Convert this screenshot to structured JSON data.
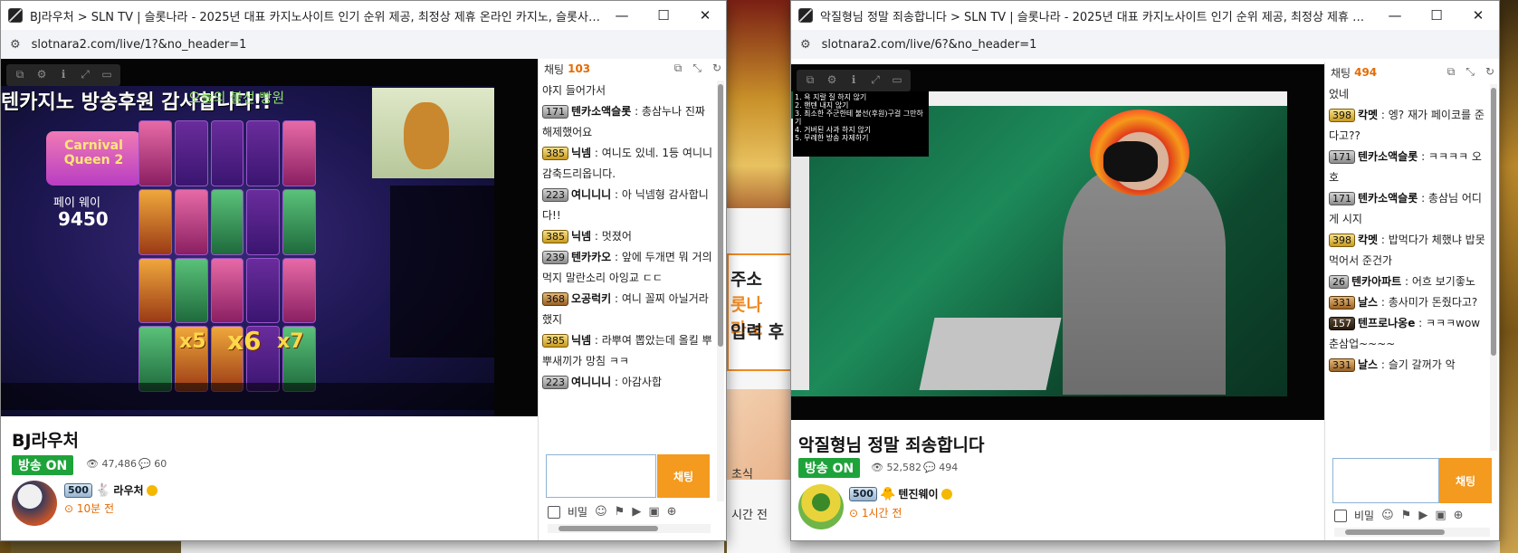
{
  "background": {
    "promo_line1": "주소",
    "promo_line2": "롯나라.c",
    "promo_line3": "입력 후",
    "side_text_1": "초식",
    "side_text_2": "시간 전"
  },
  "window1": {
    "title": "BJ라우처 > SLN TV | 슬롯나라 - 2025년 대표 카지노사이트 인기 순위 제공, 최정상 제휴 온라인 카지노, 슬롯사이트...",
    "url": "slotnara2.com/live/1?&no_header=1",
    "video": {
      "banner": "텐카지노 방송후원 감사합니다!!",
      "banner_sub": "오늘의 불선 빵원",
      "game_logo": "Carnival Queen 2",
      "payway_label": "페이 웨이",
      "payway_value": "9450",
      "multipliers": [
        "x5",
        "x6",
        "x7"
      ]
    },
    "stream_title": "BJ라우처",
    "live_badge": "방송 ON",
    "viewers": "47,486",
    "comments": "60",
    "author_level": "500",
    "author_name": "라우처",
    "time_ago": "10분 전",
    "chat": {
      "label": "채팅",
      "count": "103",
      "messages": [
        {
          "level": "",
          "tier": "",
          "nick": "",
          "text": "야지 들어가서"
        },
        {
          "level": "171",
          "tier": "silver",
          "nick": "텐카소액슬롯",
          "text": "총삼누나 진짜해제했어요"
        },
        {
          "level": "385",
          "tier": "gold",
          "nick": "닉넴",
          "text": "여니도 있네. 1등 여니니 감축드리옵니다."
        },
        {
          "level": "223",
          "tier": "silver",
          "nick": "여니니니",
          "text": "아 닉넴형 감사합니다!!"
        },
        {
          "level": "385",
          "tier": "gold",
          "nick": "닉넴",
          "text": "멋졌어"
        },
        {
          "level": "239",
          "tier": "silver",
          "nick": "텐카카오",
          "text": "앞에 두개면 뭐 거의 먹지 말란소리 아잉교 ㄷㄷ"
        },
        {
          "level": "368",
          "tier": "bronze",
          "nick": "오공럭키",
          "text": "여니 꼴찌 아닐거라 했지"
        },
        {
          "level": "385",
          "tier": "gold",
          "nick": "닉넴",
          "text": "라뿌여 뽑았는데 올킬 뿌뿌새끼가 망침 ㅋㅋ"
        },
        {
          "level": "223",
          "tier": "silver",
          "nick": "여니니니",
          "text": "아감사합"
        }
      ],
      "send_label": "채팅",
      "secret_label": "비밀"
    }
  },
  "window2": {
    "title": "악질형님 정말 죄송합니다 > SLN TV | 슬롯나라 - 2025년 대표 카지노사이트 인기 순위 제공, 최정상 제휴 온라인 카...",
    "url": "slotnara2.com/live/6?&no_header=1",
    "video": {
      "overlay_lines": [
        "1. 욕 지랄 질 하지 않기",
        "2. 핸텐 내지 않기",
        "3. 최소한 주군한테 불선(후원)구걸 그만하기",
        "4. 거버된 사과 하지 않기",
        "5. 무례한 방송 자제하기"
      ]
    },
    "stream_title": "악질형님 정말 죄송합니다",
    "live_badge": "방송 ON",
    "viewers": "52,582",
    "comments": "494",
    "author_level": "500",
    "author_name": "텐진웨이",
    "time_ago": "1시간 전",
    "chat": {
      "label": "채팅",
      "count": "494",
      "messages": [
        {
          "level": "",
          "tier": "",
          "nick": "",
          "text": "었네"
        },
        {
          "level": "398",
          "tier": "gold",
          "nick": "칵멧",
          "text": "엥? 재가 페이코를 준다고??"
        },
        {
          "level": "171",
          "tier": "silver",
          "nick": "텐카소액슬롯",
          "text": "ㅋㅋㅋㅋ 오호"
        },
        {
          "level": "171",
          "tier": "silver",
          "nick": "텐카소액슬롯",
          "text": "총삼님 어디게 시지"
        },
        {
          "level": "398",
          "tier": "gold",
          "nick": "칵멧",
          "text": "밥먹다가 체했냐 밥못먹어서 준건가"
        },
        {
          "level": "26",
          "tier": "silver",
          "nick": "텐카아파트",
          "text": "어흐 보기좋노"
        },
        {
          "level": "331",
          "tier": "bronze",
          "nick": "날스",
          "text": "총사미가 돈줬다고?"
        },
        {
          "level": "157",
          "tier": "dark",
          "nick": "텐프로나옹e",
          "text": "ㅋㅋㅋwow춘삼업~~~~"
        },
        {
          "level": "331",
          "tier": "bronze",
          "nick": "날스",
          "text": "슬기 갈꺼가 악"
        }
      ],
      "send_label": "채팅",
      "secret_label": "비밀"
    }
  },
  "colors": {
    "live_green": "#1ea33a",
    "accent_orange": "#f39a1f",
    "count_orange": "#e66a00"
  }
}
